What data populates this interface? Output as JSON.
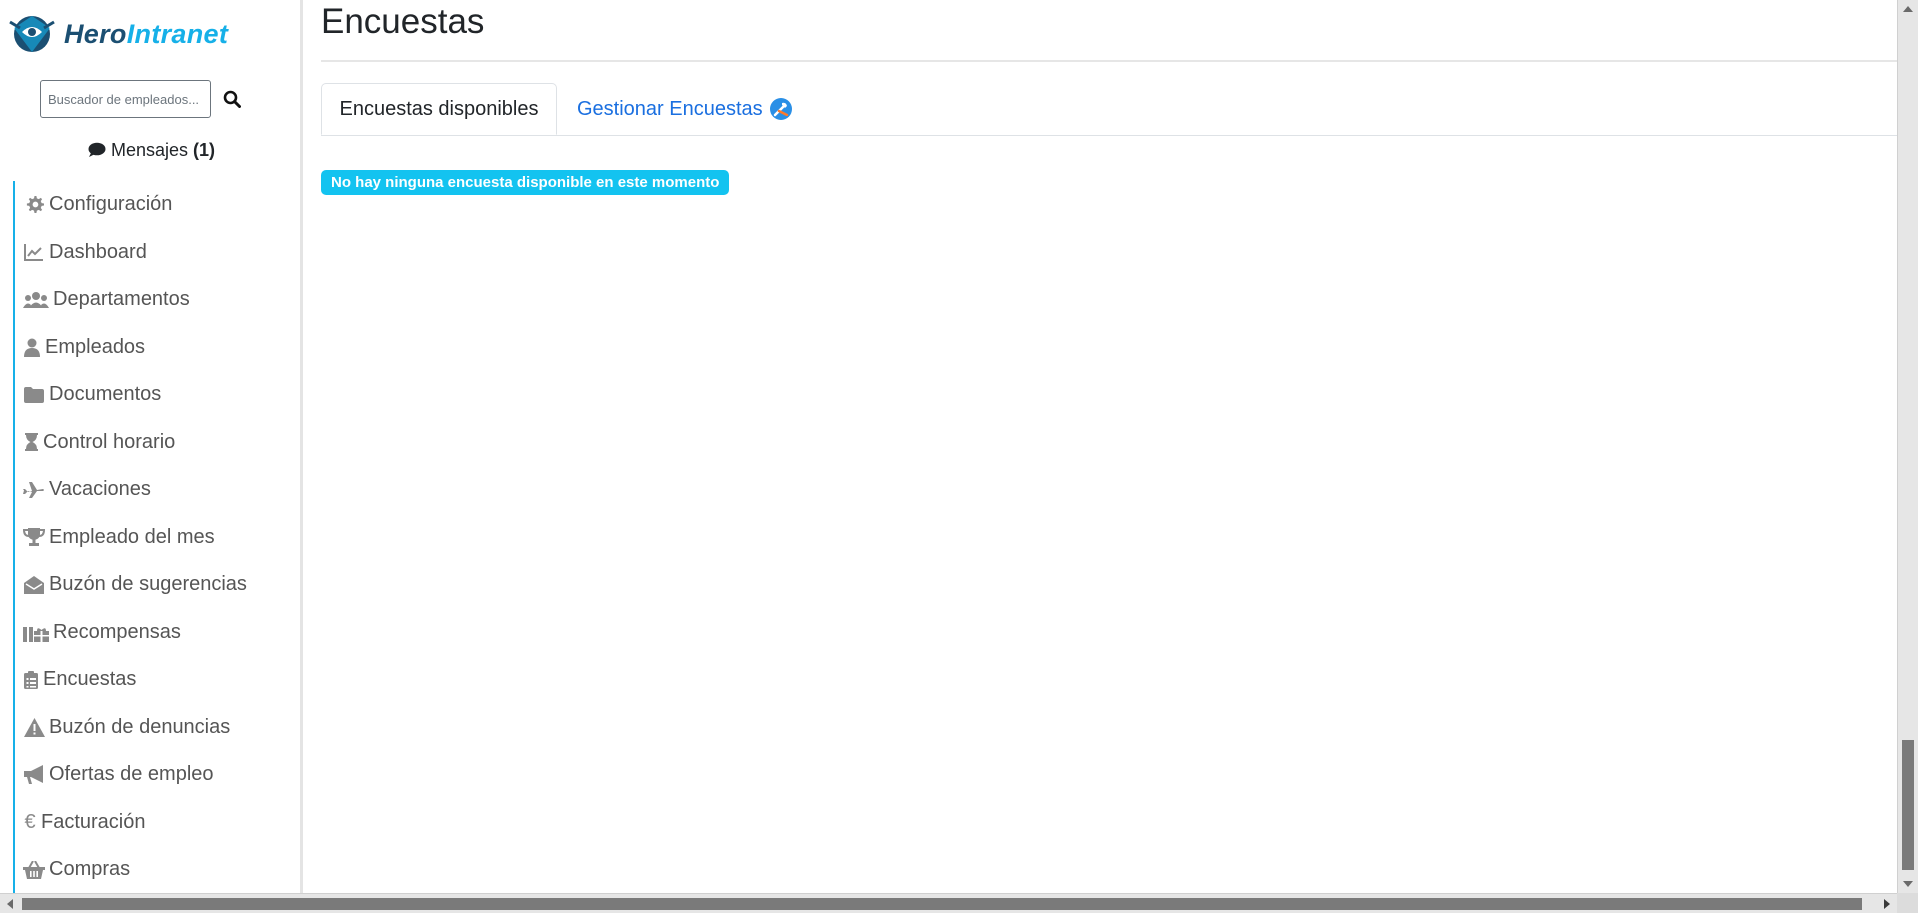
{
  "brand": {
    "part1": "Hero",
    "part2": "Intranet"
  },
  "search": {
    "placeholder": "Buscador de empleados..."
  },
  "messages": {
    "label": "Mensajes",
    "count": "(1)"
  },
  "sidebar": {
    "items": [
      {
        "label": "Configuración",
        "icon": "gear-icon"
      },
      {
        "label": "Dashboard",
        "icon": "chart-line-icon"
      },
      {
        "label": "Departamentos",
        "icon": "users-icon"
      },
      {
        "label": "Empleados",
        "icon": "user-icon"
      },
      {
        "label": "Documentos",
        "icon": "folder-icon"
      },
      {
        "label": "Control horario",
        "icon": "hourglass-icon"
      },
      {
        "label": "Vacaciones",
        "icon": "plane-icon"
      },
      {
        "label": "Empleado del mes",
        "icon": "trophy-icon"
      },
      {
        "label": "Buzón de sugerencias",
        "icon": "envelope-open-icon"
      },
      {
        "label": "Recompensas",
        "icon": "gifts-icon"
      },
      {
        "label": "Encuestas",
        "icon": "clipboard-list-icon"
      },
      {
        "label": "Buzón de denuncias",
        "icon": "warning-icon"
      },
      {
        "label": "Ofertas de empleo",
        "icon": "megaphone-icon"
      },
      {
        "label": "Facturación",
        "icon": "euro-icon"
      },
      {
        "label": "Compras",
        "icon": "basket-icon"
      }
    ]
  },
  "main": {
    "title": "Encuestas",
    "tabs": [
      {
        "label": "Encuestas disponibles",
        "active": true
      },
      {
        "label": "Gestionar Encuestas",
        "active": false,
        "icon": "tools-icon"
      }
    ],
    "alert": "No hay ninguna encuesta disponible en este momento"
  },
  "colors": {
    "accent": "#16b0e8",
    "brand_dark": "#1b4f72",
    "link": "#1a6fe0",
    "badge": "#13c3f0"
  }
}
